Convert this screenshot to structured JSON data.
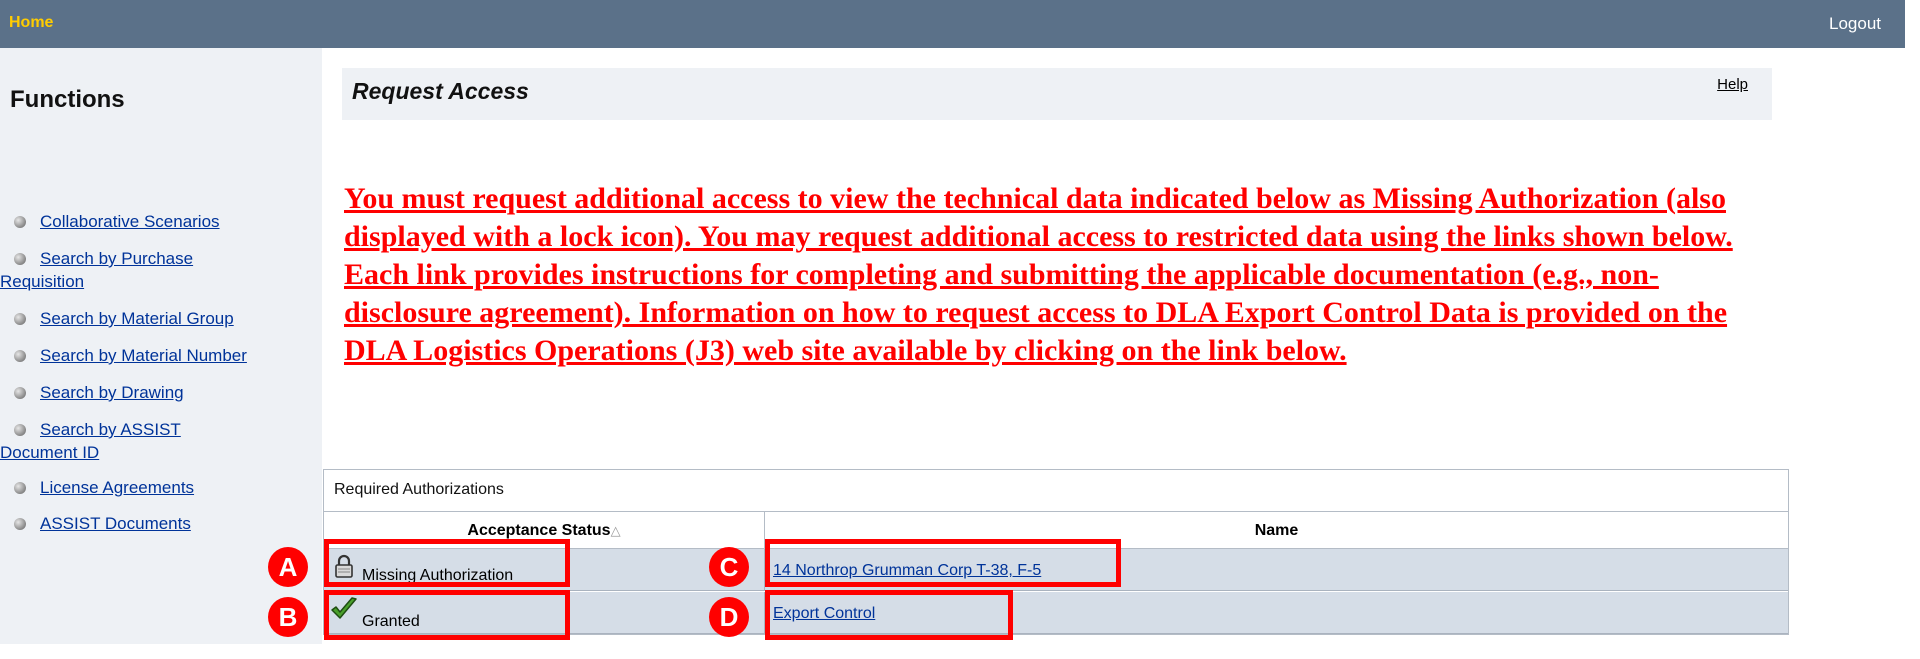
{
  "topbar": {
    "home": "Home",
    "logout": "Logout"
  },
  "sidebar": {
    "title": "Functions",
    "items": [
      {
        "label": "Collaborative Scenarios"
      },
      {
        "label": "Search by Purchase Requisition"
      },
      {
        "label": "Search by Material Group"
      },
      {
        "label": "Search by Material Number"
      },
      {
        "label": "Search by Drawing"
      },
      {
        "label": "Search by ASSIST Document ID"
      },
      {
        "label": "License Agreements"
      },
      {
        "label": "ASSIST Documents"
      }
    ]
  },
  "content": {
    "title": "Request Access",
    "help": "Help",
    "warning": "You must request additional access to view the technical data indicated below as Missing Authorization (also displayed with a lock icon). You may request additional access to restricted data using the links shown below. Each link provides instructions for completing and submitting the applicable documentation (e.g., non-disclosure agreement). Information on how to request access to DLA Export Control Data is provided on the DLA Logistics Operations (J3) web site available by clicking on the link below."
  },
  "table": {
    "caption": "Required Authorizations",
    "headers": {
      "status": "Acceptance Status",
      "sort_arrow": "△",
      "name": "Name"
    },
    "rows": [
      {
        "status": "Missing Authorization",
        "status_icon": "lock-icon",
        "name": "14 Northrop Grumman Corp T-38, F-5"
      },
      {
        "status": "Granted",
        "status_icon": "check-icon",
        "name": "Export Control"
      }
    ]
  },
  "annotations": {
    "a": "A",
    "b": "B",
    "c": "C",
    "d": "D",
    "color": "#ff0000"
  },
  "colors": {
    "topbar": "#5b7189",
    "home": "#ffcc00",
    "warning": "#ff0000",
    "link": "#003399",
    "row": "#d5dde7"
  }
}
